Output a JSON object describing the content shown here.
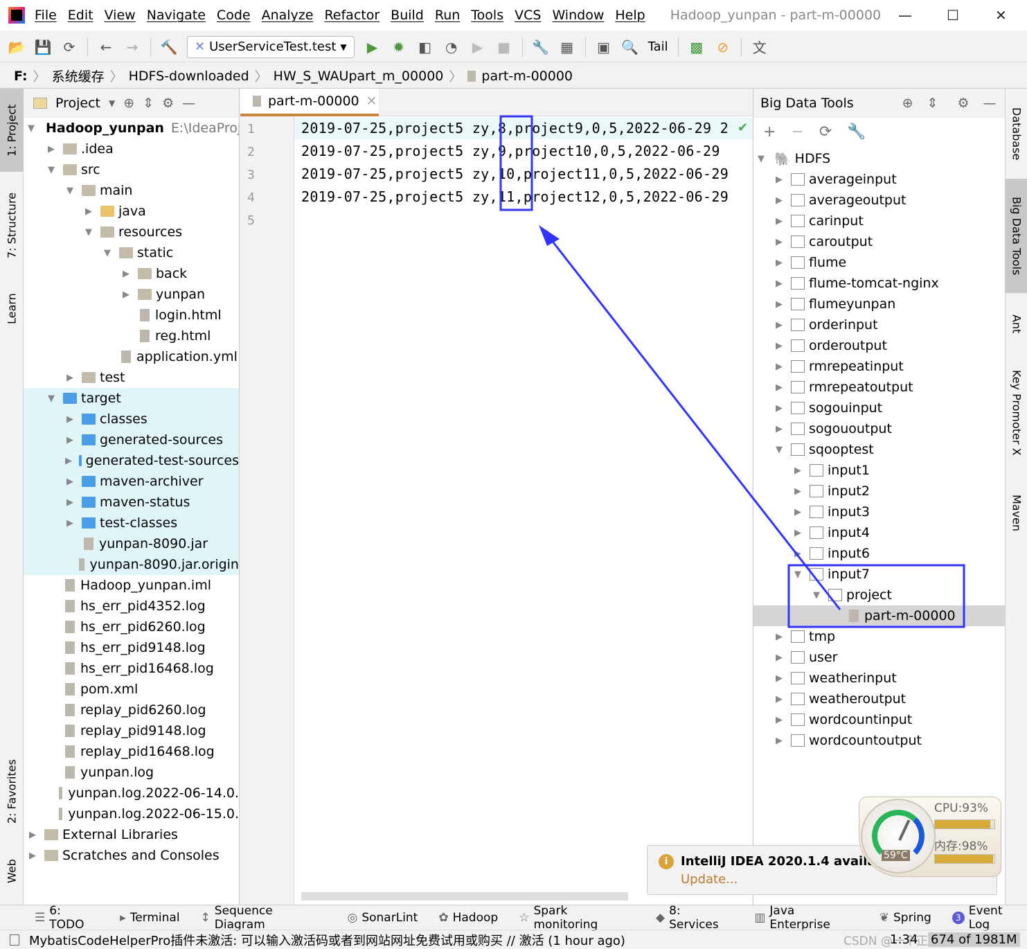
{
  "window": {
    "menu": [
      "File",
      "Edit",
      "View",
      "Navigate",
      "Code",
      "Analyze",
      "Refactor",
      "Build",
      "Run",
      "Tools",
      "VCS",
      "Window",
      "Help"
    ],
    "title": "Hadoop_yunpan - part-m-00000"
  },
  "toolbar": {
    "run_config": "UserServiceTest.test",
    "tail": "Tail"
  },
  "breadcrumb": [
    "F:",
    "系统缓存",
    "HDFS-downloaded",
    "HW_S_WAUpart_m_00000",
    "part-m-00000"
  ],
  "left_strip": [
    "1: Project",
    "7: Structure",
    "Learn",
    "2: Favorites",
    "Web"
  ],
  "right_strip": [
    "Database",
    "Big Data Tools",
    "Ant",
    "Key Promoter X",
    "Maven"
  ],
  "project": {
    "title": "Project",
    "root_path": "E:\\IdeaProje",
    "items": [
      {
        "label": "Hadoop_yunpan",
        "lvl": 0,
        "arr": "open",
        "ic": "folder",
        "bold": true
      },
      {
        "label": ".idea",
        "lvl": 1,
        "arr": "closed",
        "ic": "folder"
      },
      {
        "label": "src",
        "lvl": 1,
        "arr": "open",
        "ic": "folder"
      },
      {
        "label": "main",
        "lvl": 2,
        "arr": "open",
        "ic": "folder"
      },
      {
        "label": "java",
        "lvl": 3,
        "arr": "closed",
        "ic": "java"
      },
      {
        "label": "resources",
        "lvl": 3,
        "arr": "open",
        "ic": "folder"
      },
      {
        "label": "static",
        "lvl": 4,
        "arr": "open",
        "ic": "folder"
      },
      {
        "label": "back",
        "lvl": 5,
        "arr": "closed",
        "ic": "folder"
      },
      {
        "label": "yunpan",
        "lvl": 5,
        "arr": "closed",
        "ic": "folder"
      },
      {
        "label": "login.html",
        "lvl": 5,
        "ic": "file"
      },
      {
        "label": "reg.html",
        "lvl": 5,
        "ic": "file"
      },
      {
        "label": "application.yml",
        "lvl": 4,
        "ic": "file"
      },
      {
        "label": "test",
        "lvl": 2,
        "arr": "closed",
        "ic": "folder"
      },
      {
        "label": "target",
        "lvl": 1,
        "arr": "open",
        "ic": "blue",
        "hl": true
      },
      {
        "label": "classes",
        "lvl": 2,
        "arr": "closed",
        "ic": "blue",
        "hl": true
      },
      {
        "label": "generated-sources",
        "lvl": 2,
        "arr": "closed",
        "ic": "blue",
        "hl": true
      },
      {
        "label": "generated-test-sources",
        "lvl": 2,
        "arr": "closed",
        "ic": "blue",
        "hl": true
      },
      {
        "label": "maven-archiver",
        "lvl": 2,
        "arr": "closed",
        "ic": "blue",
        "hl": true
      },
      {
        "label": "maven-status",
        "lvl": 2,
        "arr": "closed",
        "ic": "blue",
        "hl": true
      },
      {
        "label": "test-classes",
        "lvl": 2,
        "arr": "closed",
        "ic": "blue",
        "hl": true
      },
      {
        "label": "yunpan-8090.jar",
        "lvl": 2,
        "ic": "file",
        "hl": true
      },
      {
        "label": "yunpan-8090.jar.origin",
        "lvl": 2,
        "ic": "file",
        "hl": true
      },
      {
        "label": "Hadoop_yunpan.iml",
        "lvl": 1,
        "ic": "file"
      },
      {
        "label": "hs_err_pid4352.log",
        "lvl": 1,
        "ic": "file"
      },
      {
        "label": "hs_err_pid6260.log",
        "lvl": 1,
        "ic": "file"
      },
      {
        "label": "hs_err_pid9148.log",
        "lvl": 1,
        "ic": "file"
      },
      {
        "label": "hs_err_pid16468.log",
        "lvl": 1,
        "ic": "file"
      },
      {
        "label": "pom.xml",
        "lvl": 1,
        "ic": "file"
      },
      {
        "label": "replay_pid6260.log",
        "lvl": 1,
        "ic": "file"
      },
      {
        "label": "replay_pid9148.log",
        "lvl": 1,
        "ic": "file"
      },
      {
        "label": "replay_pid16468.log",
        "lvl": 1,
        "ic": "file"
      },
      {
        "label": "yunpan.log",
        "lvl": 1,
        "ic": "file"
      },
      {
        "label": "yunpan.log.2022-06-14.0.",
        "lvl": 1,
        "ic": "file"
      },
      {
        "label": "yunpan.log.2022-06-15.0.",
        "lvl": 1,
        "ic": "file"
      },
      {
        "label": "External Libraries",
        "lvl": 0,
        "arr": "closed",
        "ic": "folder"
      },
      {
        "label": "Scratches and Consoles",
        "lvl": 0,
        "arr": "closed",
        "ic": "folder"
      }
    ]
  },
  "editor": {
    "tab": "part-m-00000",
    "lines": [
      "2019-07-25,project5 zy,8,project9,0,5,2022-06-29 2",
      "2019-07-25,project5 zy,9,project10,0,5,2022-06-29",
      "2019-07-25,project5 zy,10,project11,0,5,2022-06-29",
      "2019-07-25,project5 zy,11,project12,0,5,2022-06-29",
      ""
    ]
  },
  "bigdata": {
    "title": "Big Data Tools",
    "root": "HDFS",
    "items": [
      {
        "label": "averageinput",
        "lvl": 1
      },
      {
        "label": "averageoutput",
        "lvl": 1
      },
      {
        "label": "carinput",
        "lvl": 1
      },
      {
        "label": "caroutput",
        "lvl": 1
      },
      {
        "label": "flume",
        "lvl": 1
      },
      {
        "label": "flume-tomcat-nginx",
        "lvl": 1
      },
      {
        "label": "flumeyunpan",
        "lvl": 1
      },
      {
        "label": "orderinput",
        "lvl": 1
      },
      {
        "label": "orderoutput",
        "lvl": 1
      },
      {
        "label": "rmrepeatinput",
        "lvl": 1
      },
      {
        "label": "rmrepeatoutput",
        "lvl": 1
      },
      {
        "label": "sogouinput",
        "lvl": 1
      },
      {
        "label": "sogououtput",
        "lvl": 1
      },
      {
        "label": "sqooptest",
        "lvl": 1,
        "open": true
      },
      {
        "label": "input1",
        "lvl": 2
      },
      {
        "label": "input2",
        "lvl": 2
      },
      {
        "label": "input3",
        "lvl": 2
      },
      {
        "label": "input4",
        "lvl": 2
      },
      {
        "label": "input6",
        "lvl": 2
      },
      {
        "label": "input7",
        "lvl": 2,
        "open": true
      },
      {
        "label": "project",
        "lvl": 3,
        "open": true
      },
      {
        "label": "part-m-00000",
        "lvl": 4,
        "file": true,
        "selected": true
      },
      {
        "label": "tmp",
        "lvl": 1
      },
      {
        "label": "user",
        "lvl": 1
      },
      {
        "label": "weatherinput",
        "lvl": 1
      },
      {
        "label": "weatheroutput",
        "lvl": 1
      },
      {
        "label": "wordcountinput",
        "lvl": 1
      },
      {
        "label": "wordcountoutput",
        "lvl": 1
      }
    ]
  },
  "notification": {
    "title": "IntelliJ IDEA 2020.1.4 available",
    "action": "Update..."
  },
  "monitor": {
    "cpu_label": "CPU:93%",
    "cpu": 93,
    "mem_label": "内存:98%",
    "mem": 98,
    "temp": "59°C"
  },
  "toolwindows": [
    "6: TODO",
    "Terminal",
    "Sequence Diagram",
    "SonarLint",
    "Hadoop",
    "Spark monitoring",
    "8: Services",
    "Java Enterprise",
    "Spring",
    "Event Log"
  ],
  "event_count": "3",
  "status": {
    "message": "MybatisCodeHelperPro插件未激活: 可以输入激活码或者到网站网址免费试用或购买 // 激活 (1 hour ago)",
    "position": "1:34",
    "memory": "674 of 1981M",
    "watermark": "CSDN @一个正在努力的菜鸡"
  },
  "colors": {
    "annotation": "#3333ff",
    "tab_accent": "#c7853c",
    "target_highlight": "#dff5f8"
  }
}
